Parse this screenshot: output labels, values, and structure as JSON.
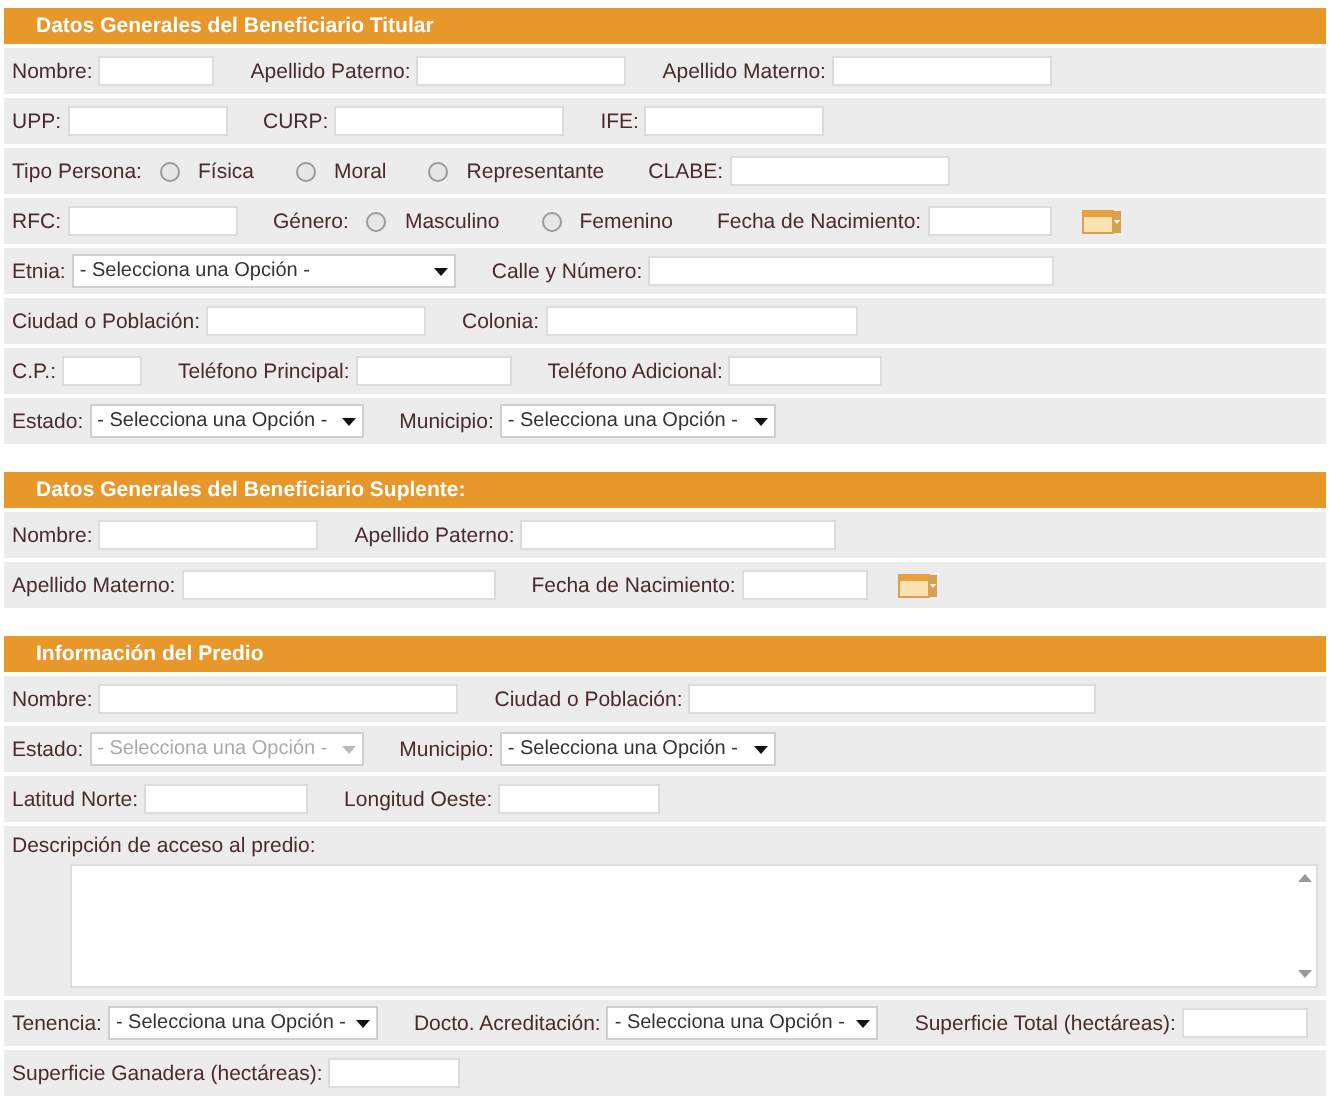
{
  "sections": [
    {
      "title": "Datos Generales del Beneficiario Titular",
      "rows": [
        [
          {
            "kind": "text",
            "label": "Nombre:"
          },
          {
            "kind": "text",
            "label": "Apellido Paterno:"
          },
          {
            "kind": "text",
            "label": "Apellido Materno:"
          }
        ],
        [
          {
            "kind": "text",
            "label": "UPP:"
          },
          {
            "kind": "text",
            "label": "CURP:"
          },
          {
            "kind": "text",
            "label": "IFE:"
          }
        ],
        [
          {
            "kind": "radio",
            "label": "Tipo Persona:",
            "options": [
              {
                "label": "Física",
                "selected": false
              },
              {
                "label": "Moral",
                "selected": false
              },
              {
                "label": "Representante",
                "selected": false
              }
            ]
          },
          {
            "kind": "text",
            "label": "CLABE:"
          }
        ],
        [
          {
            "kind": "text",
            "label": "RFC:"
          },
          {
            "kind": "radio",
            "label": "Género:",
            "options": [
              {
                "label": "Masculino",
                "selected": false
              },
              {
                "label": "Femenino",
                "selected": false
              }
            ]
          },
          {
            "kind": "date",
            "label": "Fecha de Nacimiento:"
          }
        ],
        [
          {
            "kind": "select",
            "label": "Etnia:",
            "value": "- Selecciona una Opción -",
            "disabled": false
          },
          {
            "kind": "text",
            "label": "Calle y Número:"
          }
        ],
        [
          {
            "kind": "text",
            "label": "Ciudad o Población:"
          },
          {
            "kind": "text",
            "label": "Colonia:"
          }
        ],
        [
          {
            "kind": "text",
            "label": "C.P.:"
          },
          {
            "kind": "text",
            "label": "Teléfono Principal:"
          },
          {
            "kind": "text",
            "label": "Teléfono Adicional:"
          }
        ],
        [
          {
            "kind": "select",
            "label": "Estado:",
            "value": "- Selecciona una Opción -",
            "disabled": false
          },
          {
            "kind": "select",
            "label": "Municipio:",
            "value": "- Selecciona una Opción -",
            "disabled": false
          }
        ]
      ]
    },
    {
      "title": "Datos Generales del Beneficiario Suplente:",
      "rows": [
        [
          {
            "kind": "text",
            "label": "Nombre:"
          },
          {
            "kind": "text",
            "label": "Apellido Paterno:"
          }
        ],
        [
          {
            "kind": "text",
            "label": "Apellido Materno:"
          },
          {
            "kind": "date",
            "label": "Fecha de Nacimiento:"
          }
        ]
      ]
    },
    {
      "title": "Información del Predio",
      "rows": [
        [
          {
            "kind": "text",
            "label": "Nombre:"
          },
          {
            "kind": "text",
            "label": "Ciudad o Población:"
          }
        ],
        [
          {
            "kind": "select",
            "label": "Estado:",
            "value": "- Selecciona una Opción -",
            "disabled": true
          },
          {
            "kind": "select",
            "label": "Municipio:",
            "value": "- Selecciona una Opción -",
            "disabled": false
          }
        ],
        [
          {
            "kind": "text",
            "label": "Latitud Norte:"
          },
          {
            "kind": "text",
            "label": "Longitud Oeste:"
          }
        ],
        [
          {
            "kind": "textarea",
            "label": "Descripción de acceso al predio:"
          }
        ],
        [
          {
            "kind": "select",
            "label": "Tenencia:",
            "value": "- Selecciona una Opción -",
            "disabled": false
          },
          {
            "kind": "select",
            "label": "Docto. Acreditación:",
            "value": "- Selecciona una Opción -",
            "disabled": false
          },
          {
            "kind": "text",
            "label": "Superficie Total (hectáreas):"
          }
        ],
        [
          {
            "kind": "text",
            "label": "Superficie Ganadera (hectáreas):"
          }
        ]
      ]
    }
  ]
}
